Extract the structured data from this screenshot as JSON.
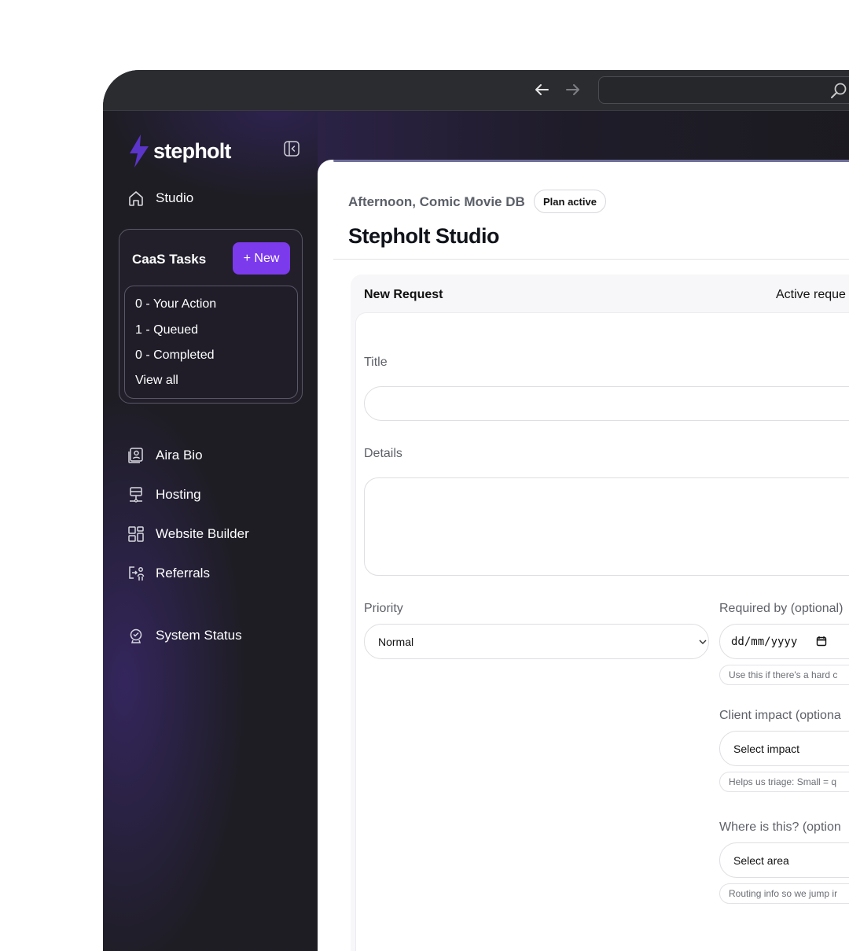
{
  "browser": {
    "back_icon": "arrow-left-icon",
    "forward_icon": "arrow-right-icon",
    "search_icon": "search-icon"
  },
  "sidebar": {
    "logo_text": "stepholt",
    "brand_color": "#7c3aed",
    "top_item": {
      "label": "Studio",
      "icon": "home-icon"
    },
    "tasks": {
      "title": "CaaS Tasks",
      "new_button": "+ New",
      "links": [
        "0 - Your Action",
        "1 - Queued",
        "0 - Completed",
        "View all"
      ]
    },
    "items": [
      {
        "label": "Aira Bio",
        "icon": "profile-card-icon"
      },
      {
        "label": "Hosting",
        "icon": "server-icon"
      },
      {
        "label": "Website Builder",
        "icon": "layout-grid-icon"
      },
      {
        "label": "Referrals",
        "icon": "referral-icon"
      },
      {
        "label": "System Status",
        "icon": "status-icon"
      }
    ]
  },
  "header": {
    "greeting": "Afternoon, Comic Movie DB",
    "plan_badge": "Plan active",
    "title": "Stepholt Studio"
  },
  "form": {
    "tabs": {
      "new_request": "New Request",
      "active_requests": "Active reque"
    },
    "title_label": "Title",
    "details_label": "Details",
    "priority_label": "Priority",
    "priority_value": "Normal",
    "required_by_label": "Required by (optional)",
    "required_by_placeholder": "dd/mm/yyyy",
    "required_by_hint": "Use this if there's a hard c",
    "client_impact_label": "Client impact (optiona",
    "client_impact_value": "Select impact",
    "client_impact_hint": "Helps us triage: Small = q",
    "where_label": "Where is this? (option",
    "where_value": "Select area",
    "where_hint": "Routing info so we jump ir"
  }
}
